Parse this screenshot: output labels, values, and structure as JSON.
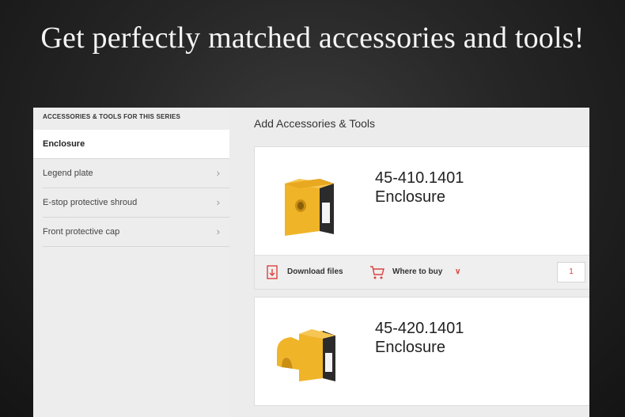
{
  "headline": "Get perfectly matched accessories and tools!",
  "sidebar": {
    "header": "ACCESSORIES & TOOLS FOR THIS SERIES",
    "items": [
      {
        "label": "Enclosure",
        "active": true
      },
      {
        "label": "Legend plate"
      },
      {
        "label": "E-stop protective shroud"
      },
      {
        "label": "Front protective cap"
      }
    ]
  },
  "main": {
    "title": "Add Accessories & Tools",
    "cards": [
      {
        "part_number": "45-410.1401",
        "name": "Enclosure",
        "download_label": "Download files",
        "buy_label": "Where to buy",
        "quantity": "1",
        "icon": "enclosure-box"
      },
      {
        "part_number": "45-420.1401",
        "name": "Enclosure",
        "icon": "enclosure-with-shroud"
      }
    ]
  },
  "colors": {
    "accent": "#d9423e",
    "product_yellow": "#f0b429",
    "product_black": "#2b2b2b"
  }
}
